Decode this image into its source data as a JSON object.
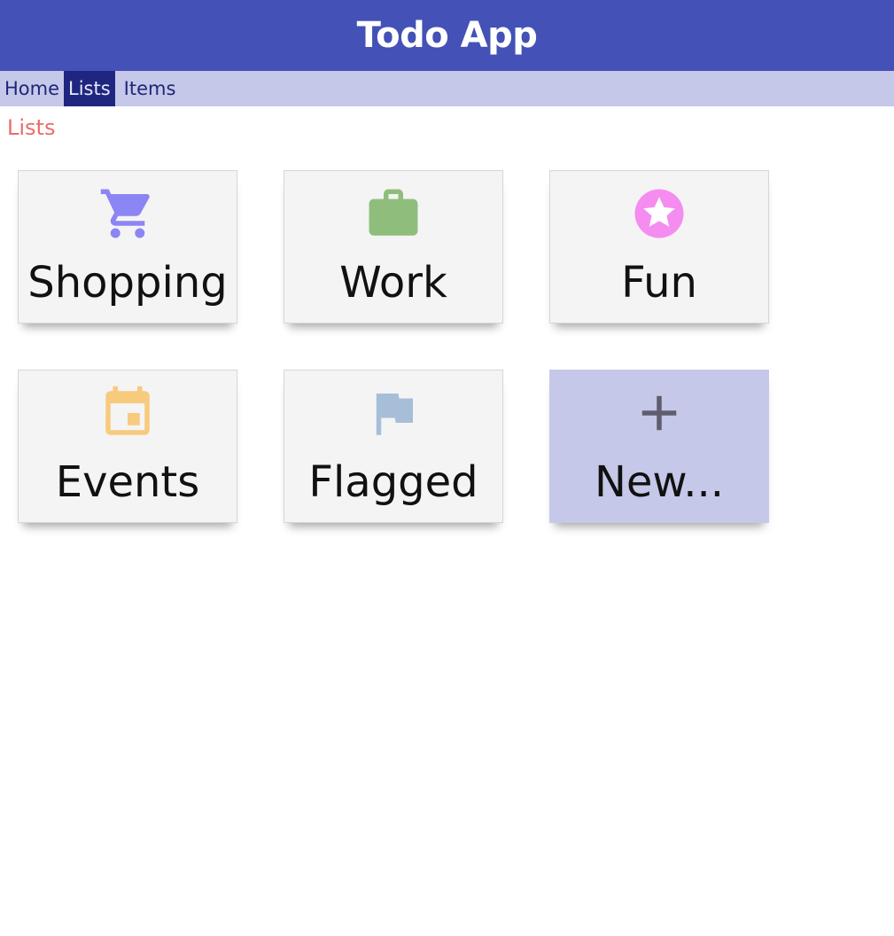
{
  "header": {
    "title": "Todo App"
  },
  "nav": {
    "items": [
      {
        "label": "Home"
      },
      {
        "label": "Lists"
      },
      {
        "label": "Items"
      }
    ],
    "active": "Lists"
  },
  "page": {
    "heading": "Lists"
  },
  "tiles": [
    {
      "label": "Shopping",
      "icon": "shopping-cart-icon",
      "color": "#8b85f5"
    },
    {
      "label": "Work",
      "icon": "briefcase-icon",
      "color": "#8fbe7c"
    },
    {
      "label": "Fun",
      "icon": "star-icon",
      "color": "#f58cf0"
    },
    {
      "label": "Events",
      "icon": "calendar-icon",
      "color": "#f7ca7d"
    },
    {
      "label": "Flagged",
      "icon": "flag-icon",
      "color": "#a7bed8"
    },
    {
      "label": "New...",
      "icon": "plus-icon",
      "color": "#5e5e6e"
    }
  ],
  "colors": {
    "header_bg": "#4451b6",
    "nav_bg": "#c5c8e8",
    "nav_active_bg": "#1f2680",
    "heading": "#ec6b6b",
    "tile_bg": "#f4f4f4",
    "new_tile_bg": "#c5c8e8"
  }
}
